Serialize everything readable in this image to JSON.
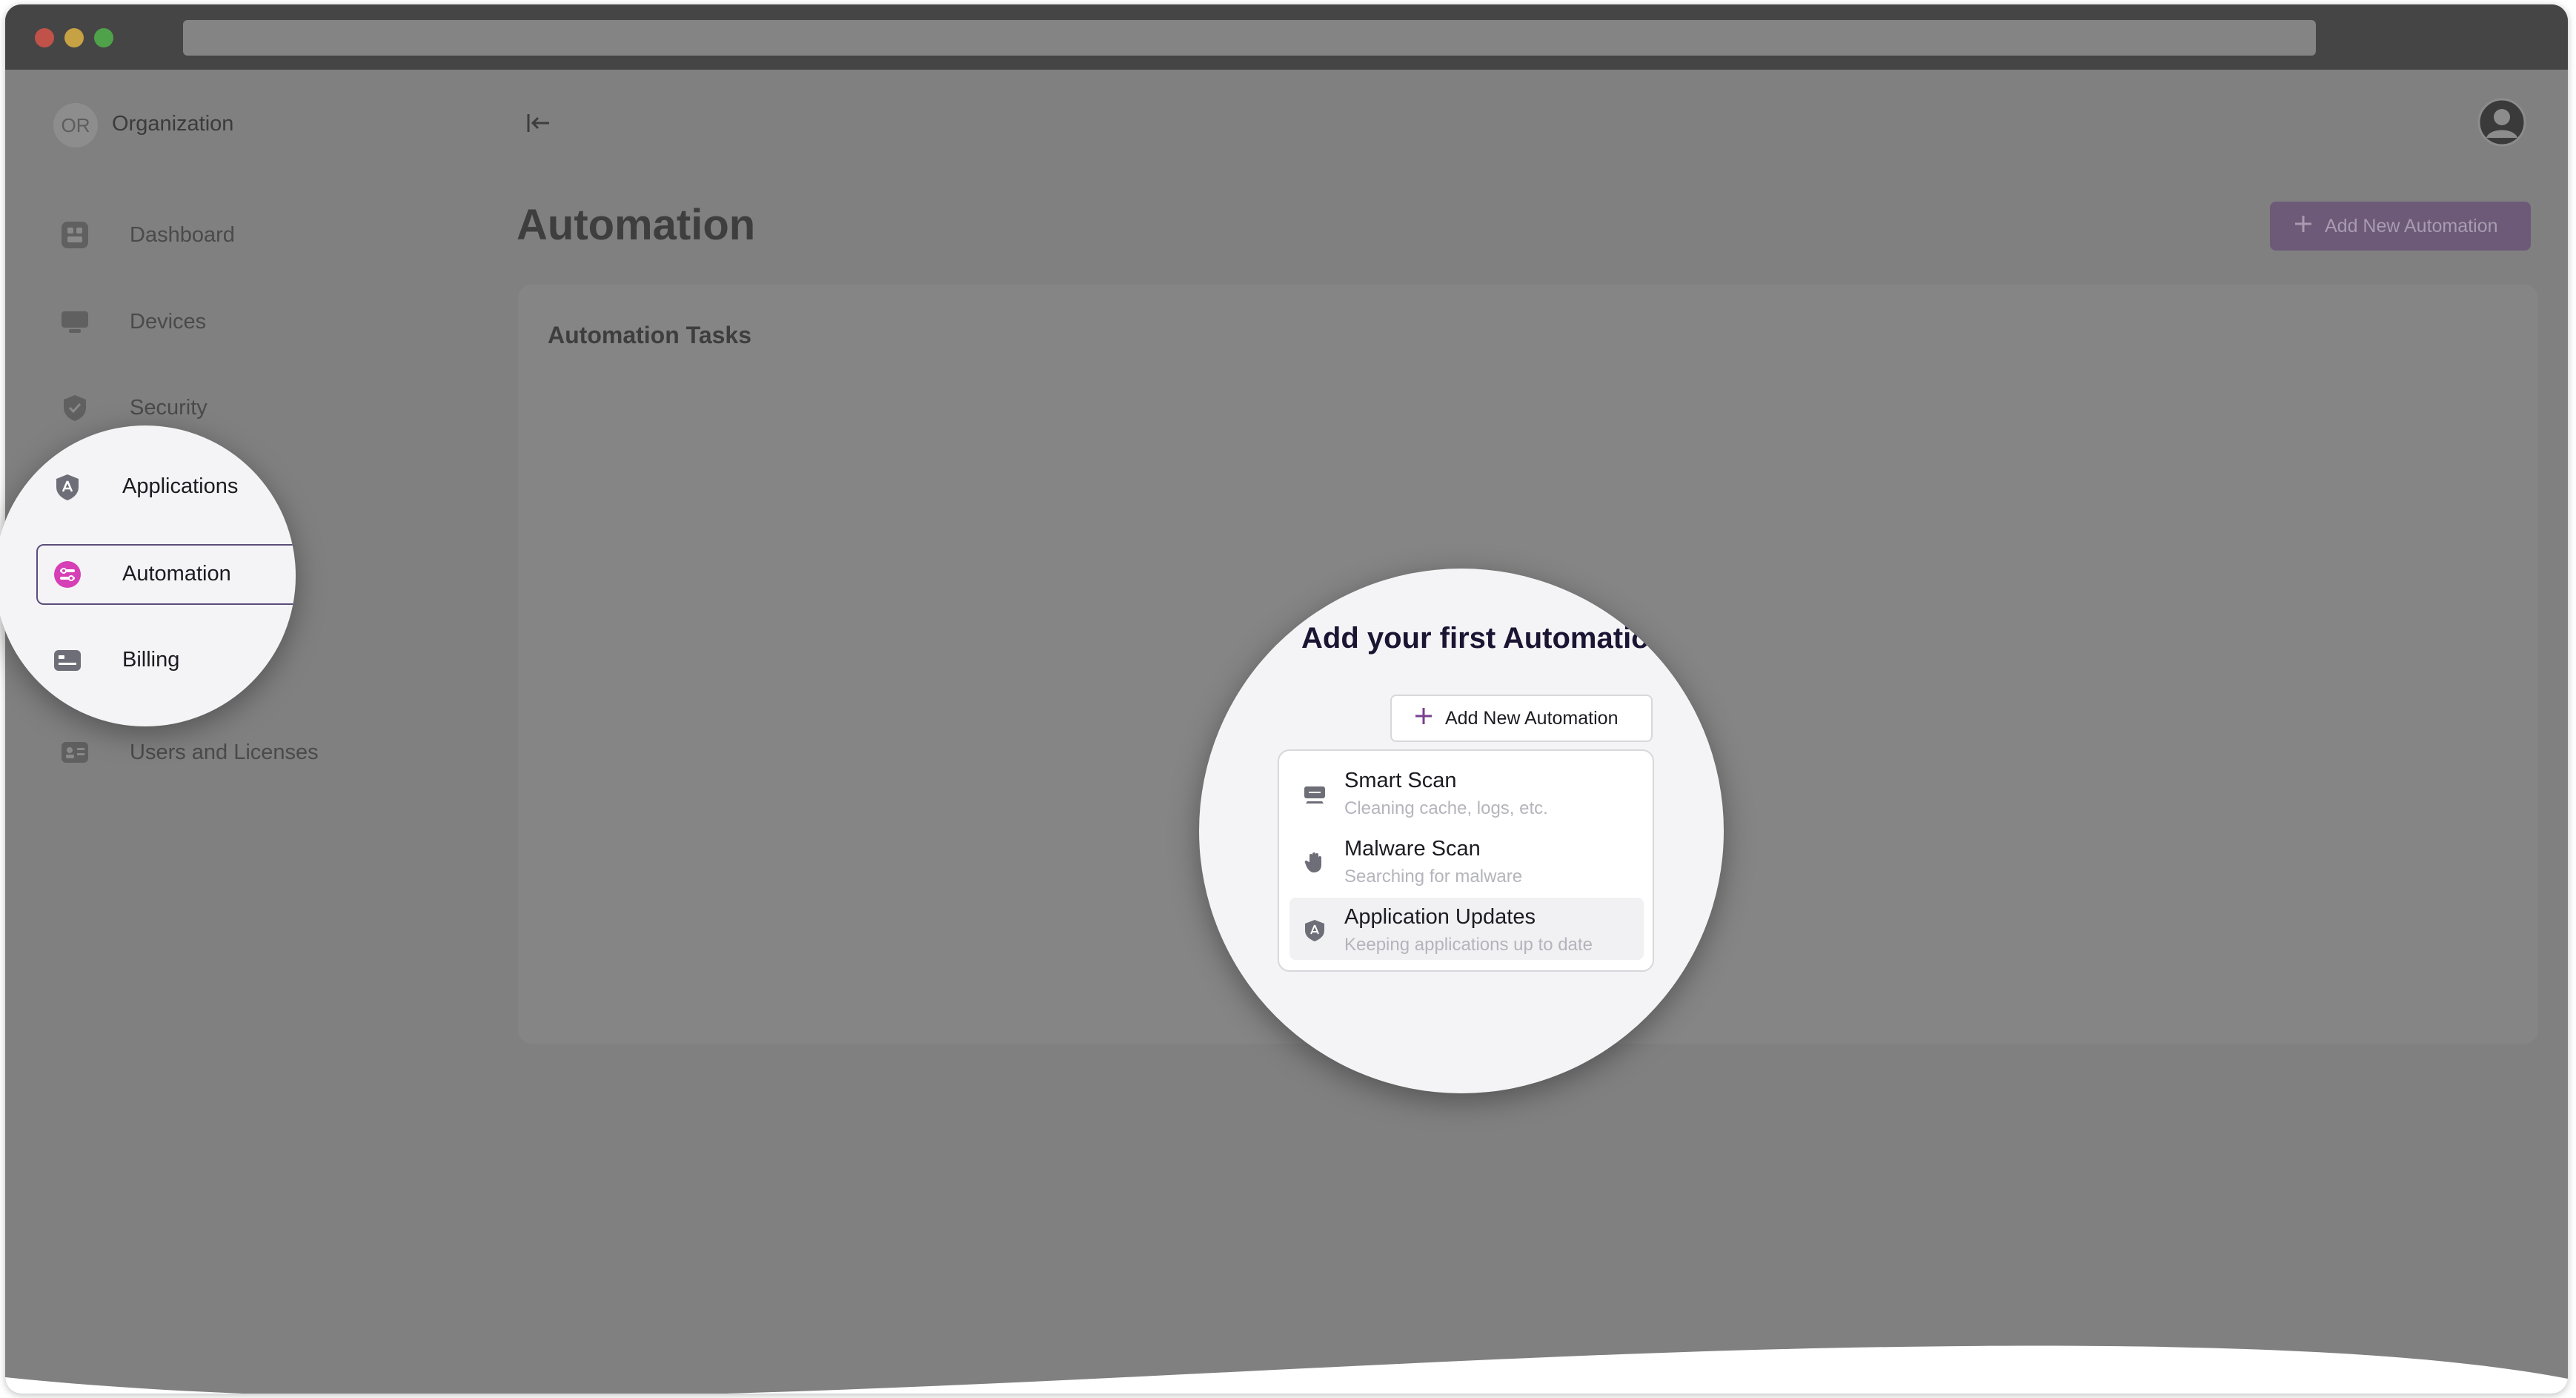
{
  "org": {
    "initials": "OR",
    "name": "Organization"
  },
  "sidebar": {
    "items": [
      {
        "label": "Dashboard",
        "icon": "dashboard-icon"
      },
      {
        "label": "Devices",
        "icon": "devices-icon"
      },
      {
        "label": "Security",
        "icon": "shield-icon"
      },
      {
        "label": "Applications",
        "icon": "applications-icon"
      },
      {
        "label": "Automation",
        "icon": "automation-icon",
        "active": true
      },
      {
        "label": "Billing",
        "icon": "billing-icon"
      },
      {
        "label": "Users and Licenses",
        "icon": "users-icon"
      }
    ]
  },
  "header": {
    "title": "Automation",
    "add_button": "Add New Automation"
  },
  "tasks": {
    "title": "Automation Tasks"
  },
  "empty_state": {
    "title": "Add your first Automation task",
    "add_button": "Add New Automation",
    "menu": [
      {
        "title": "Smart Scan",
        "subtitle": "Cleaning cache, logs, etc.",
        "icon": "smart-scan-icon"
      },
      {
        "title": "Malware Scan",
        "subtitle": "Searching for malware",
        "icon": "hand-icon"
      },
      {
        "title": "Application Updates",
        "subtitle": "Keeping applications up to date",
        "icon": "app-updates-icon"
      }
    ]
  },
  "colors": {
    "accent": "#7a3f8f",
    "automation_pink": "#d63fb6",
    "overlay": "#808080"
  }
}
